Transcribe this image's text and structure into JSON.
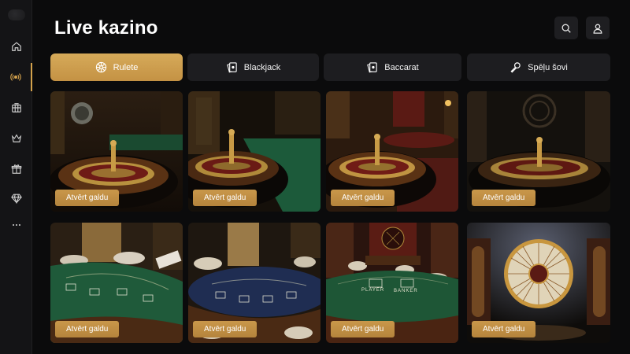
{
  "header": {
    "title": "Live kazino"
  },
  "sidebar": {
    "items": [
      {
        "icon": "home-icon"
      },
      {
        "icon": "live-broadcast-icon"
      },
      {
        "icon": "casino-machine-icon"
      },
      {
        "icon": "crown-icon"
      },
      {
        "icon": "gift-icon"
      },
      {
        "icon": "diamond-icon"
      },
      {
        "icon": "more-icon"
      }
    ]
  },
  "tabs": [
    {
      "label": "Rulete",
      "icon": "roulette-icon",
      "active": true
    },
    {
      "label": "Blackjack",
      "icon": "cards-icon",
      "active": false
    },
    {
      "label": "Baccarat",
      "icon": "cards-icon",
      "active": false
    },
    {
      "label": "Spēļu šovi",
      "icon": "microphone-icon",
      "active": false
    }
  ],
  "games": [
    {
      "type": "roulette",
      "button": "Atvērt galdu"
    },
    {
      "type": "roulette",
      "button": "Atvērt galdu"
    },
    {
      "type": "roulette",
      "button": "Atvērt galdu"
    },
    {
      "type": "roulette",
      "button": "Atvērt galdu"
    },
    {
      "type": "blackjack",
      "button": "Atvērt galdu"
    },
    {
      "type": "blackjack",
      "button": "Atvērt galdu"
    },
    {
      "type": "baccarat",
      "button": "Atvērt galdu",
      "table_labels": [
        "PLAYER",
        "BANKER"
      ]
    },
    {
      "type": "wheel",
      "button": "Atvērt galdu"
    }
  ],
  "colors": {
    "accent": "#d4a24c",
    "background": "#0b0b0c",
    "panel": "#1d1d20",
    "felt_green": "#1f5a3a"
  }
}
